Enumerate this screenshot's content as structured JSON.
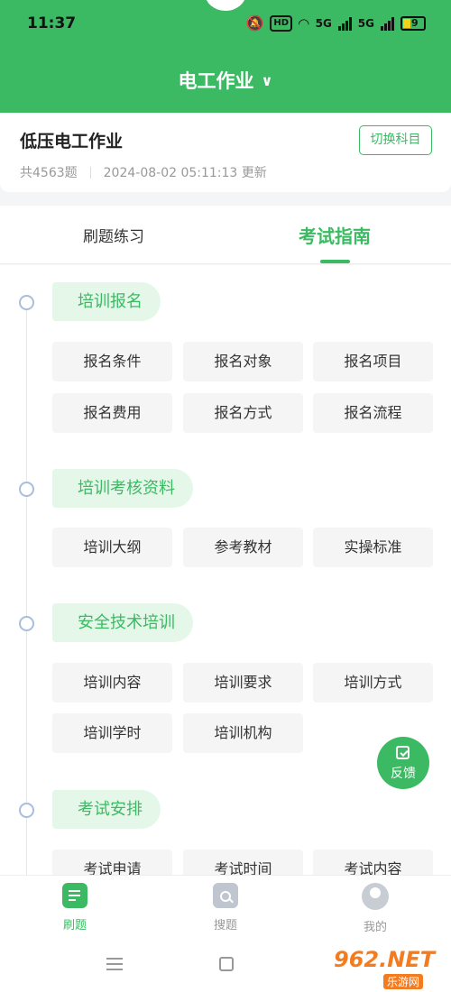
{
  "status_bar": {
    "time": "11:37",
    "hd": "HD",
    "net1": "5G",
    "net2": "5G",
    "battery": "9"
  },
  "header": {
    "title": "电工作业"
  },
  "course": {
    "title": "低压电工作业",
    "switch_label": "切换科目",
    "count": "共4563题",
    "updated": "2024-08-02 05:11:13 更新"
  },
  "tabs": [
    {
      "label": "刷题练习"
    },
    {
      "label": "考试指南"
    }
  ],
  "sections": [
    {
      "title": "培训报名",
      "items": [
        "报名条件",
        "报名对象",
        "报名项目",
        "报名费用",
        "报名方式",
        "报名流程"
      ]
    },
    {
      "title": "培训考核资料",
      "items": [
        "培训大纲",
        "参考教材",
        "实操标准"
      ]
    },
    {
      "title": "安全技术培训",
      "items": [
        "培训内容",
        "培训要求",
        "培训方式",
        "培训学时",
        "培训机构"
      ]
    },
    {
      "title": "考试安排",
      "items": [
        "考试申请",
        "考试时间",
        "考试内容"
      ]
    }
  ],
  "feedback": {
    "label": "反馈"
  },
  "nav": [
    {
      "label": "刷题"
    },
    {
      "label": "搜题"
    },
    {
      "label": "我的"
    }
  ],
  "watermark": {
    "text": "962.NET",
    "sub": "乐游网"
  },
  "colors": {
    "accent": "#3cba63",
    "chip_bg": "#f5f5f6",
    "section_bg": "#e4f7e9"
  }
}
